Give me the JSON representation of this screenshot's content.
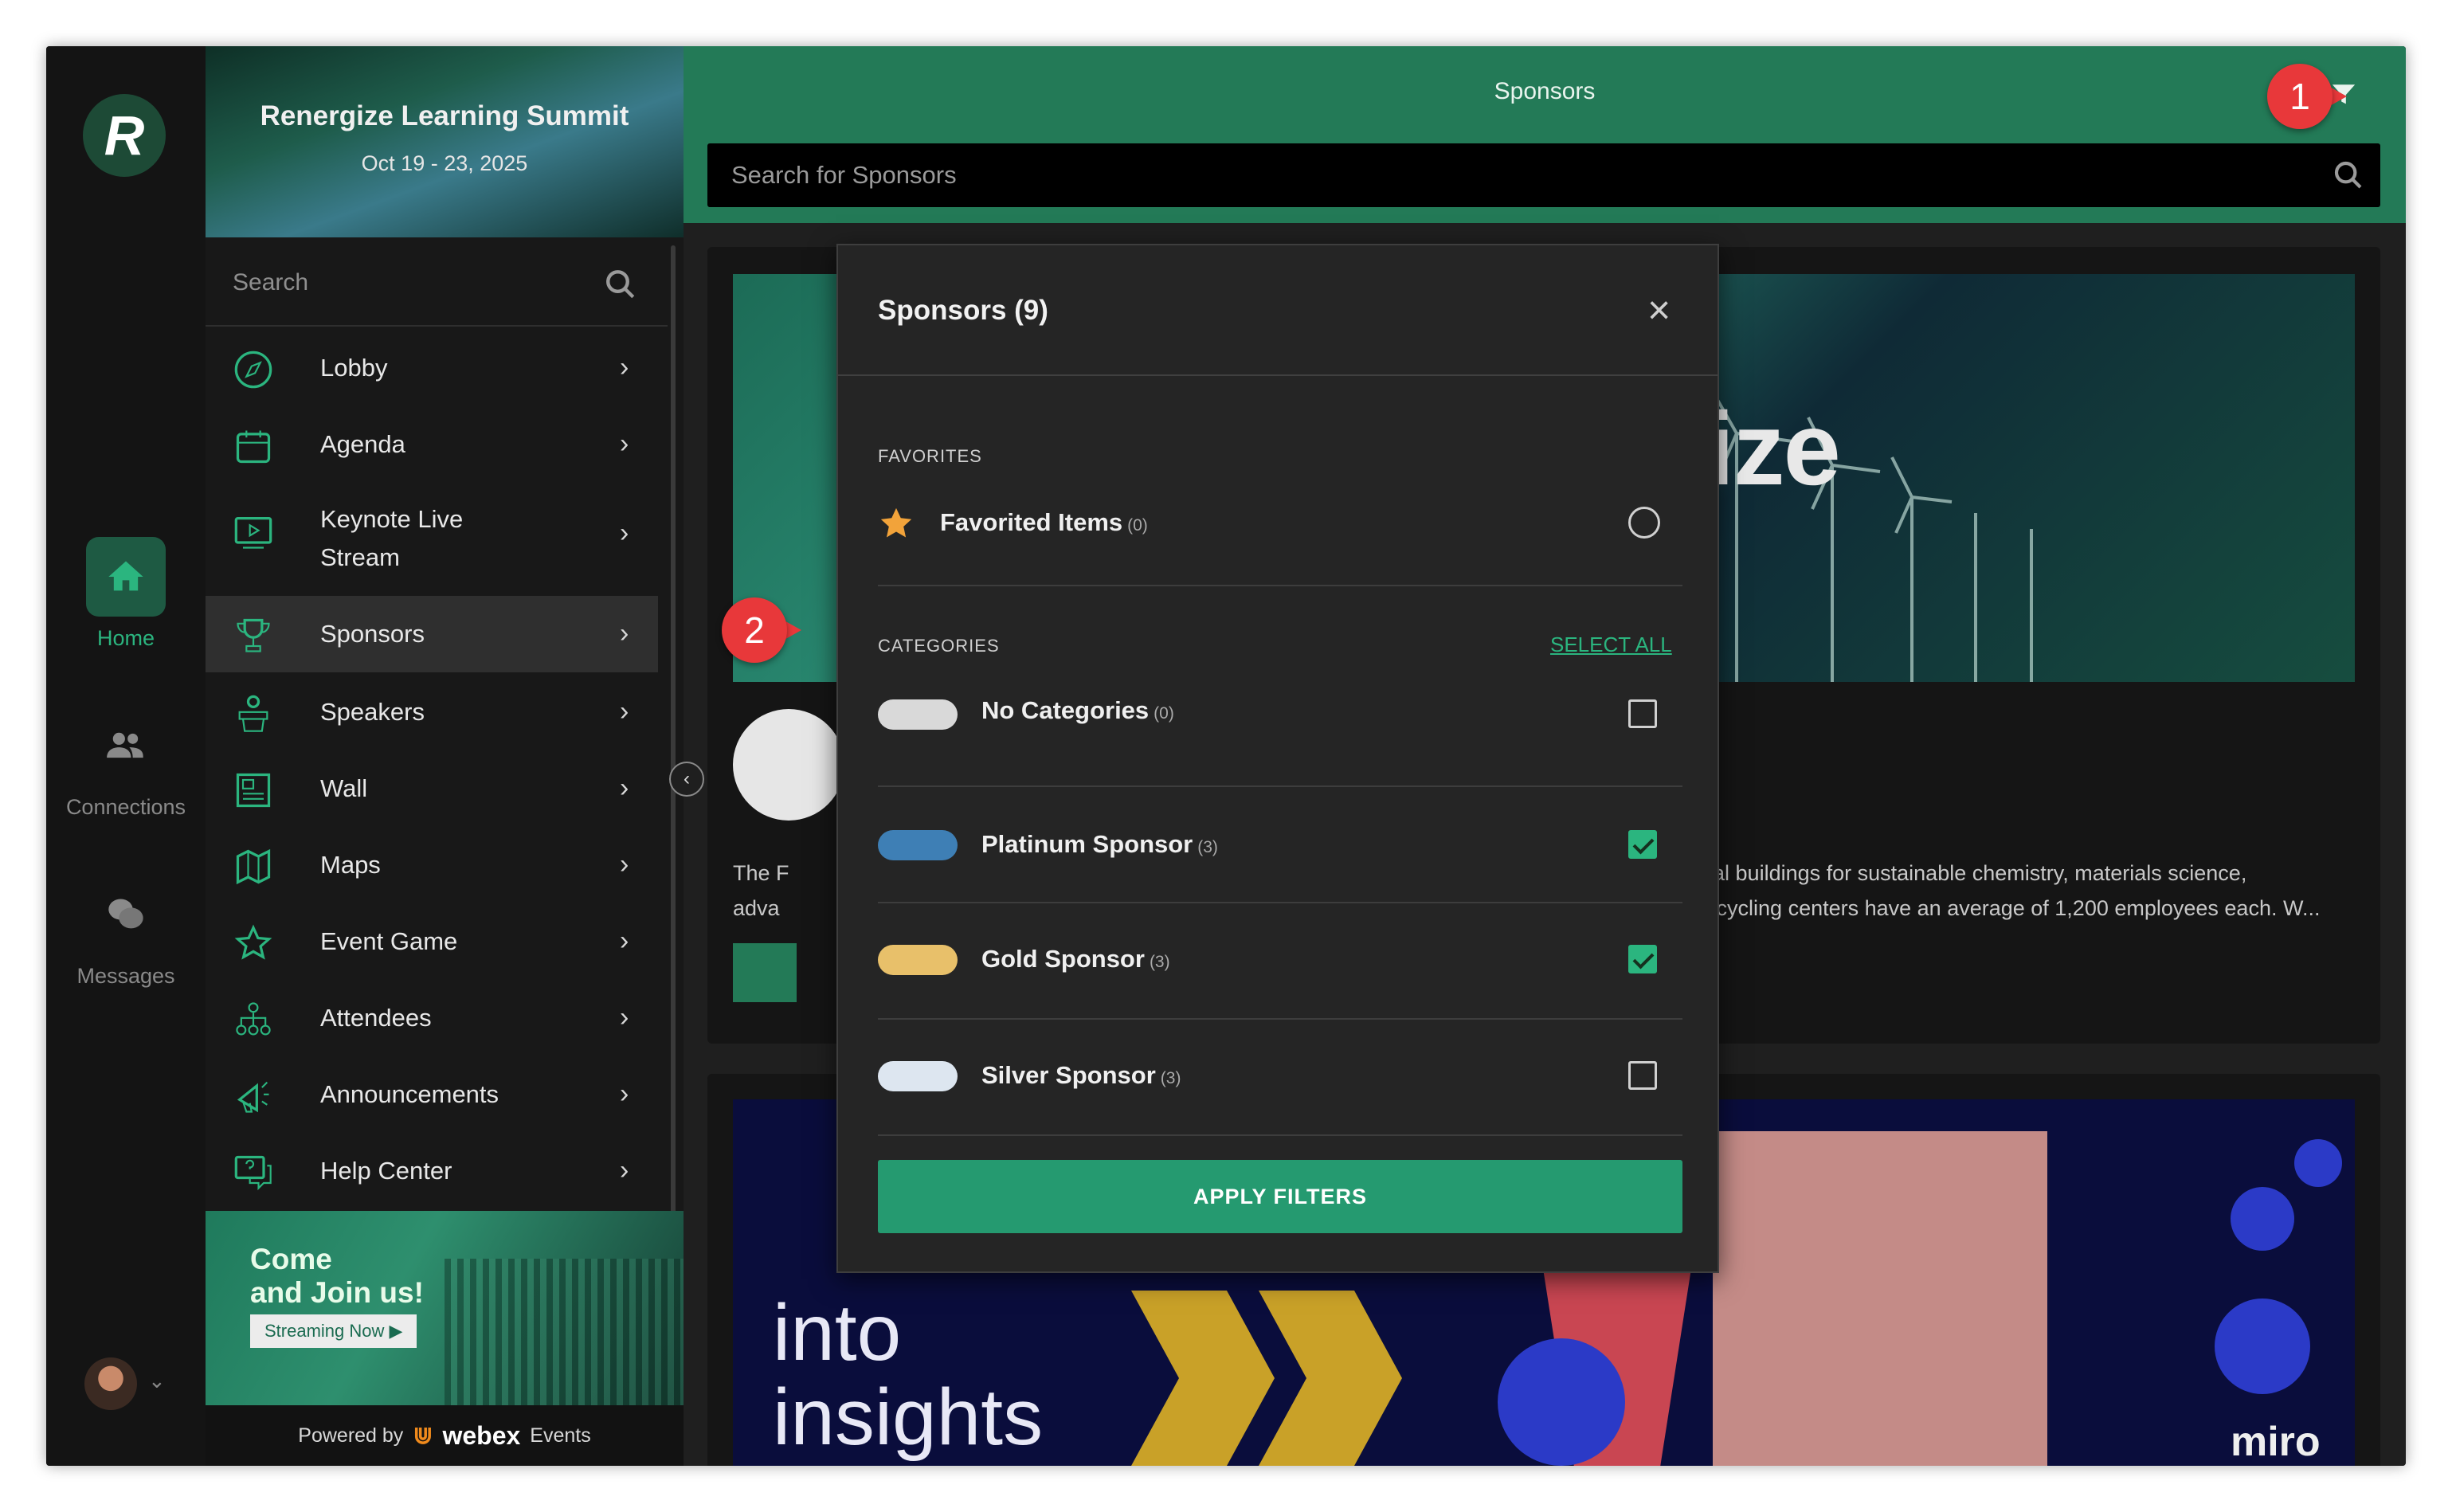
{
  "event": {
    "title": "Renergize Learning Summit",
    "dates": "Oct 19 - 23, 2025"
  },
  "rail": {
    "logo": "R",
    "items": [
      {
        "label": "Home",
        "icon": "home-icon"
      },
      {
        "label": "Connections",
        "icon": "people-icon"
      },
      {
        "label": "Messages",
        "icon": "chat-icon"
      }
    ]
  },
  "sidebar": {
    "search_placeholder": "Search",
    "items": [
      {
        "label": "Lobby",
        "icon": "compass-icon"
      },
      {
        "label": "Agenda",
        "icon": "calendar-icon"
      },
      {
        "label": "Keynote Live\nStream",
        "icon": "video-icon"
      },
      {
        "label": "Sponsors",
        "icon": "trophy-icon"
      },
      {
        "label": "Speakers",
        "icon": "podium-icon"
      },
      {
        "label": "Wall",
        "icon": "news-icon"
      },
      {
        "label": "Maps",
        "icon": "map-icon"
      },
      {
        "label": "Event Game",
        "icon": "star-icon"
      },
      {
        "label": "Attendees",
        "icon": "network-icon"
      },
      {
        "label": "Announcements",
        "icon": "megaphone-icon"
      },
      {
        "label": "Help Center",
        "icon": "help-chat-icon"
      }
    ],
    "promo": {
      "line1": "Come",
      "line2": "and Join us!",
      "button": "Streaming Now ▶"
    },
    "powered_by": "Powered by",
    "brand": "webex",
    "brand_suffix": "Events"
  },
  "main": {
    "title": "Sponsors",
    "search_placeholder": "Search for Sponsors",
    "card1": {
      "banner_word": "gize",
      "desc_prefix": "The F",
      "desc_prefix2": "adva",
      "desc_line1": "several buildings for sustainable chemistry, materials science,",
      "desc_line2": "our recycling centers have an average of 1,200 employees each. W..."
    },
    "card2": {
      "line1": "into",
      "line2": "insights",
      "brand": "miro"
    }
  },
  "modal": {
    "title": "Sponsors (9)",
    "favorites_header": "FAVORITES",
    "favorited": {
      "label": "Favorited Items",
      "count": "(0)"
    },
    "categories_header": "CATEGORIES",
    "select_all": "SELECT ALL",
    "categories": [
      {
        "label": "No Categories",
        "count": "(0)",
        "color": "#d9d9d9",
        "checked": false
      },
      {
        "label": "Platinum Sponsor",
        "count": "(3)",
        "color": "#3e7fb5",
        "checked": true
      },
      {
        "label": "Gold Sponsor",
        "count": "(3)",
        "color": "#e8c06a",
        "checked": true
      },
      {
        "label": "Silver Sponsor",
        "count": "(3)",
        "color": "#dde6f0",
        "checked": false
      }
    ],
    "apply": "APPLY FILTERS"
  },
  "callouts": [
    "1",
    "2"
  ],
  "colors": {
    "accent": "#237a57",
    "accent_light": "#2bb57f",
    "callout": "#e8383a"
  }
}
